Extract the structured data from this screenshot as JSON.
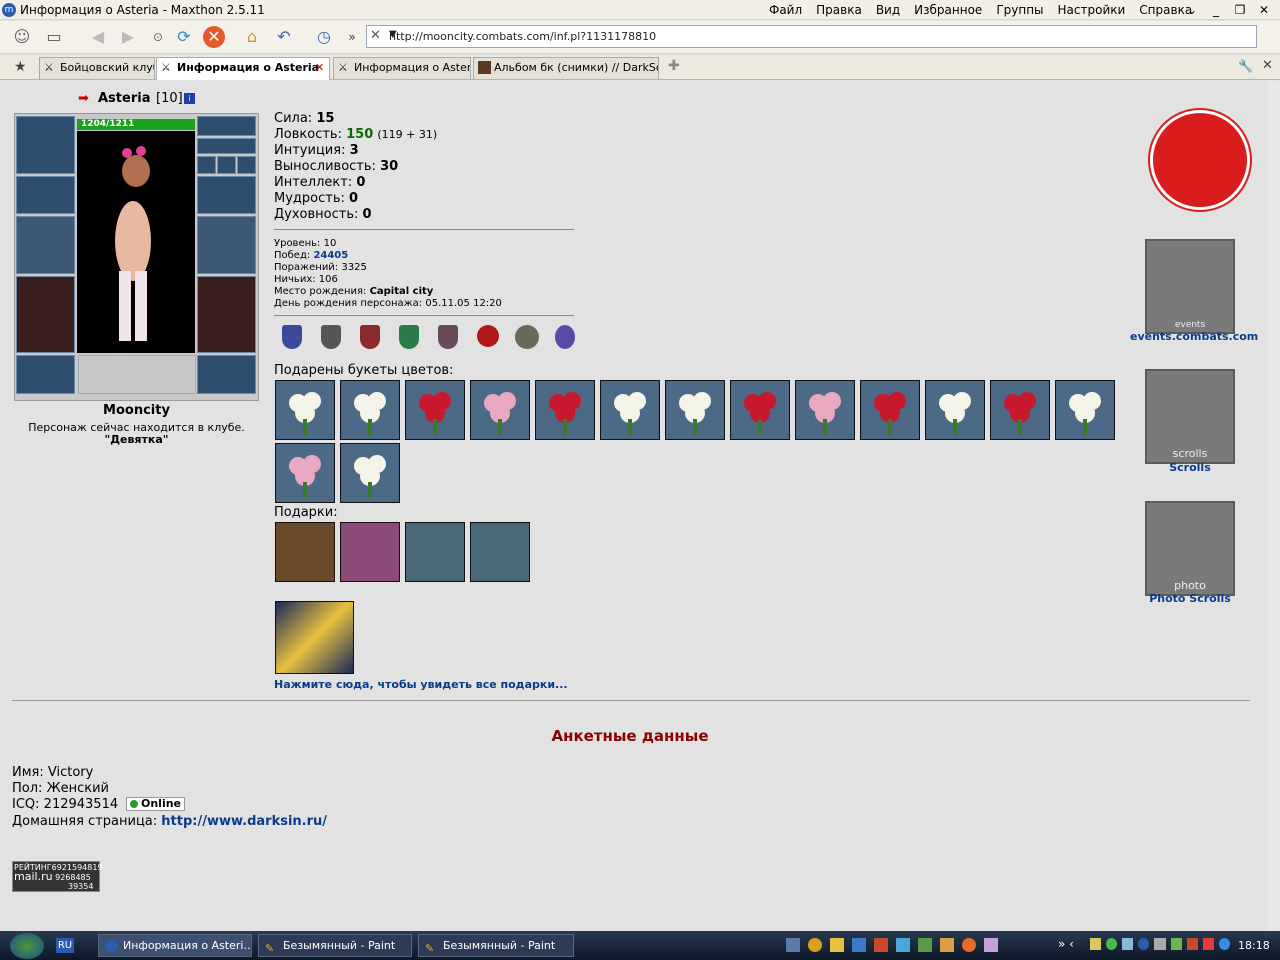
{
  "window": {
    "title": "Информация о Asteria - Maxthon 2.5.11",
    "menu": [
      "Файл",
      "Правка",
      "Вид",
      "Избранное",
      "Группы",
      "Настройки",
      "Справка"
    ]
  },
  "address": {
    "url": "http://mooncity.combats.com/inf.pl?1131178810"
  },
  "tabs": [
    "Бойцовский клуб",
    "Информация о Asteria",
    "Информация о Asteria",
    "Альбом бк (снимки) // DarkSouls"
  ],
  "character": {
    "name": "Asteria",
    "level": "[10]",
    "hp": "1204/1211",
    "city": "Mooncity",
    "status": "Персонаж сейчас находится в клубе.",
    "club": "\"Девятка\""
  },
  "stats": {
    "strength_label": "Сила:",
    "strength": "15",
    "agility_label": "Ловкость:",
    "agility": "150",
    "agility_extra": "(119 + 31)",
    "intuition_label": "Интуиция:",
    "intuition": "3",
    "endurance_label": "Выносливость:",
    "endurance": "30",
    "intellect_label": "Интеллект:",
    "intellect": "0",
    "wisdom_label": "Мудрость:",
    "wisdom": "0",
    "spirit_label": "Духовность:",
    "spirit": "0"
  },
  "info": {
    "level_label": "Уровень:",
    "level": "10",
    "wins_label": "Побед:",
    "wins": "24405",
    "losses_label": "Поражений:",
    "losses": "3325",
    "draws_label": "Ничьих:",
    "draws": "106",
    "birthplace_label": "Место рождения:",
    "birthplace": "Capital city",
    "birthday_label": "День рождения персонажа:",
    "birthday": "05.11.05 12:20"
  },
  "flowers_title": "Подарены букеты цветов:",
  "gifts_title": "Подарки:",
  "all_gifts_link": "Нажмите сюда, чтобы увидеть все подарки...",
  "side": {
    "events": "events.combats.com",
    "scrolls": "Scrolls",
    "photo": "Photo Scrolls",
    "events_caption": "events",
    "scrolls_caption": "scrolls",
    "photo_caption": "photo"
  },
  "profile": {
    "heading": "Анкетные данные",
    "name_label": "Имя:",
    "name": "Victory",
    "gender_label": "Пол:",
    "gender": "Женский",
    "icq_label": "ICQ:",
    "icq": "212943514",
    "icq_status": "Online",
    "home_label": "Домашняя страница:",
    "home": "http://www.darksin.ru/"
  },
  "counter": {
    "label1": "РЕЙТИНГ",
    "n1": "6921594819",
    "label2": "mail.ru",
    "n2": "9268485",
    "n3": "39354"
  },
  "taskbar": {
    "items": [
      "Информация о Asteri...",
      "Безымянный - Paint",
      "Безымянный - Paint"
    ],
    "lang": "RU",
    "clock": "18:18"
  },
  "colors": {
    "hp": "#1aa31a",
    "heading": "#8b0000",
    "link": "#0a3c8a",
    "agility": "#0a6a0a"
  }
}
